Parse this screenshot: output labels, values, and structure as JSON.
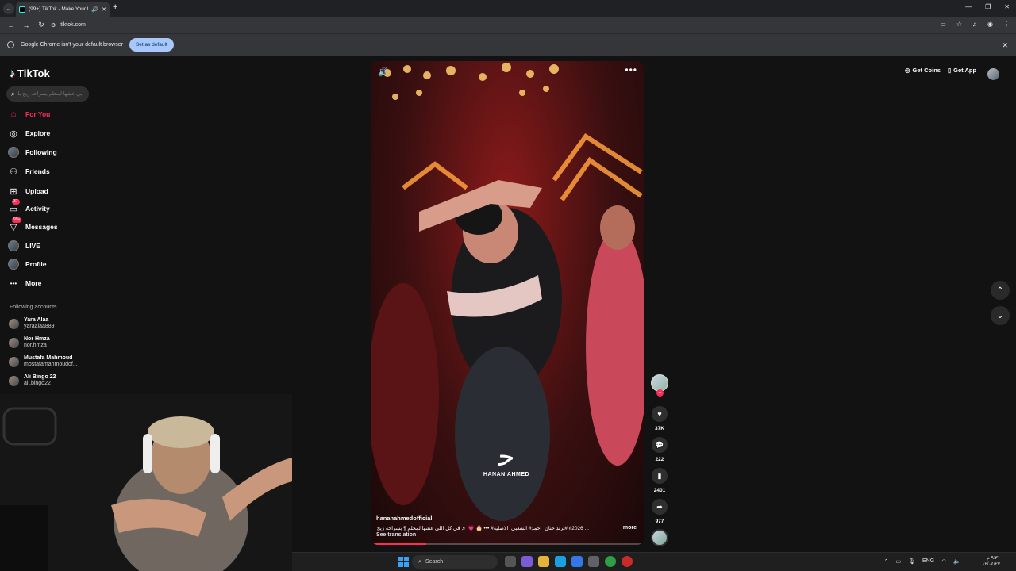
{
  "browser": {
    "tab_title": "(99+) TikTok - Make Your Day",
    "url": "tiktok.com",
    "infobar_text": "Google Chrome isn't your default browser",
    "infobar_button": "Set as default"
  },
  "tiktok": {
    "logo_text": "TikTok",
    "search_placeholder": "بي عشها لمحلم بسراحه زيج بلو",
    "nav": [
      {
        "label": "For You",
        "icon": "home-icon",
        "active": true
      },
      {
        "label": "Explore",
        "icon": "compass-icon"
      },
      {
        "label": "Following",
        "icon": "following-avatar-icon"
      },
      {
        "label": "Friends",
        "icon": "friends-icon"
      },
      {
        "label": "Upload",
        "icon": "upload-icon"
      },
      {
        "label": "Activity",
        "icon": "activity-icon",
        "badge": "37"
      },
      {
        "label": "Messages",
        "icon": "messages-icon",
        "badge": "99+"
      },
      {
        "label": "LIVE",
        "icon": "live-icon"
      },
      {
        "label": "Profile",
        "icon": "profile-avatar-icon"
      },
      {
        "label": "More",
        "icon": "more-dots-icon"
      }
    ],
    "following_title": "Following accounts",
    "following_accounts": [
      {
        "name": "Yara Alaa",
        "username": "yaraalaa889"
      },
      {
        "name": "Nor Hmza",
        "username": "nor.hmza"
      },
      {
        "name": "Mustafa Mahmoud",
        "username": "mostafamahmoudof..."
      },
      {
        "name": "Ali Bingo 22",
        "username": "ali.bingo22"
      }
    ],
    "header": {
      "get_coins": "Get Coins",
      "get_app": "Get App"
    },
    "video": {
      "watermark": "HANAN AHMED",
      "author": "hananahmedofficial",
      "caption": "... #2026 #ترند حنان_احمد# الشعبي_الاصلية# ••• 🎂 💗 ♬ ڤي كل اللي عشها لمحلم ¶ بسراحه زيج بلو",
      "more_label": "more",
      "see_translation": "See translation",
      "progress": 0.2
    },
    "actions": {
      "likes": "37K",
      "comments": "222",
      "saves": "2401",
      "shares": "977"
    }
  },
  "taskbar": {
    "search_label": "Search",
    "lang": "ENG",
    "time": "٩:٣١ م",
    "date": "١٢/٠٤/٢٣"
  }
}
